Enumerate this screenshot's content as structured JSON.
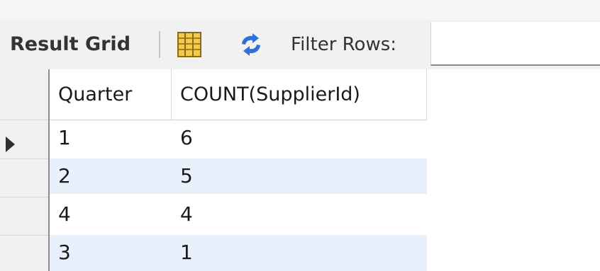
{
  "toolbar": {
    "title": "Result Grid",
    "filter_label": "Filter Rows:",
    "filter_value": ""
  },
  "grid": {
    "columns": [
      "Quarter",
      "COUNT(SupplierId)"
    ],
    "rows": [
      [
        "1",
        "6"
      ],
      [
        "2",
        "5"
      ],
      [
        "4",
        "4"
      ],
      [
        "3",
        "1"
      ]
    ],
    "current_row": 0
  },
  "colors": {
    "toolbar_bg": "#f1f1f1",
    "alt_row_bg": "#e8f0fb",
    "grid_icon": "#f2c94c",
    "refresh_icon": "#2f6fd6"
  },
  "icons": {
    "grid_icon": "grid-icon",
    "refresh_icon": "refresh-icon",
    "cursor_icon": "current-row-arrow-icon"
  }
}
